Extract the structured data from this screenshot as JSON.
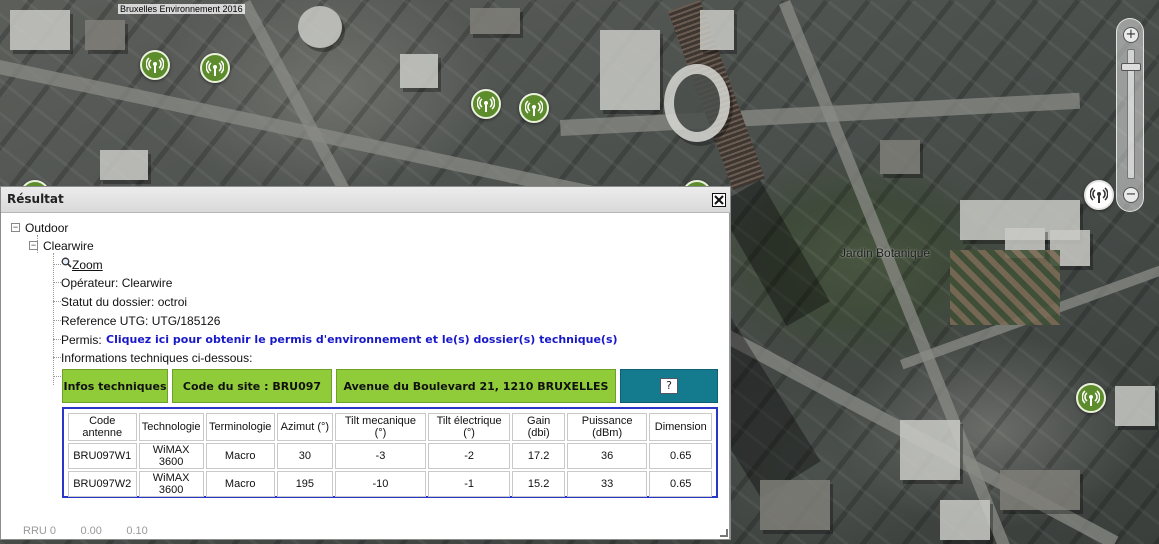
{
  "map": {
    "copyright": "Bruxelles Environnement 2016",
    "place_label": "Jardin Botanique",
    "zoom_in": "+",
    "zoom_out": "−",
    "marker_icon": "antenna-marker-icon",
    "marker_color": "#5d8c2c"
  },
  "panel": {
    "title": "Résultat",
    "close_icon": "close-icon",
    "tree": {
      "outdoor": "Outdoor",
      "clearwire": "Clearwire",
      "zoom": "Zoom",
      "operateur": "Opérateur: Clearwire",
      "statut": "Statut du dossier: octroi",
      "reference": "Reference UTG: UTG/185126",
      "permis_label": "Permis:",
      "permis_link": "Cliquez ici pour obtenir le permis d'environnement et le(s) dossier(s) technique(s)",
      "infos": "Informations techniques ci-dessous:"
    },
    "info_strip": {
      "infos_techniques": "Infos techniques",
      "code_site": "Code du site : BRU097",
      "adresse": "Avenue du Boulevard 21, 1210 BRUXELLES",
      "help": "?",
      "green": "#90cc3a",
      "teal": "#137b8d"
    },
    "table": {
      "headers": {
        "code": "Code antenne",
        "techno": "Technologie",
        "termino": "Terminologie",
        "azimut": "Azimut (°)",
        "tilt_meca": "Tilt mecanique (°)",
        "tilt_elec": "Tilt électrique (°)",
        "gain": "Gain (dbi)",
        "puissance": "Puissance (dBm)",
        "dimension": "Dimension"
      },
      "rows": [
        {
          "code": "BRU097W1",
          "techno": "WiMAX 3600",
          "termino": "Macro",
          "azimut": "30",
          "tilt_meca": "-3",
          "tilt_elec": "-2",
          "gain": "17.2",
          "puissance": "36",
          "dimension": "0.65"
        },
        {
          "code": "BRU097W2",
          "techno": "WiMAX 3600",
          "termino": "Macro",
          "azimut": "195",
          "tilt_meca": "-10",
          "tilt_elec": "-1",
          "gain": "15.2",
          "puissance": "33",
          "dimension": "0.65"
        }
      ],
      "border_color": "#2a36c9"
    },
    "ghost_row": "RRU 0        0.00        0.10"
  }
}
